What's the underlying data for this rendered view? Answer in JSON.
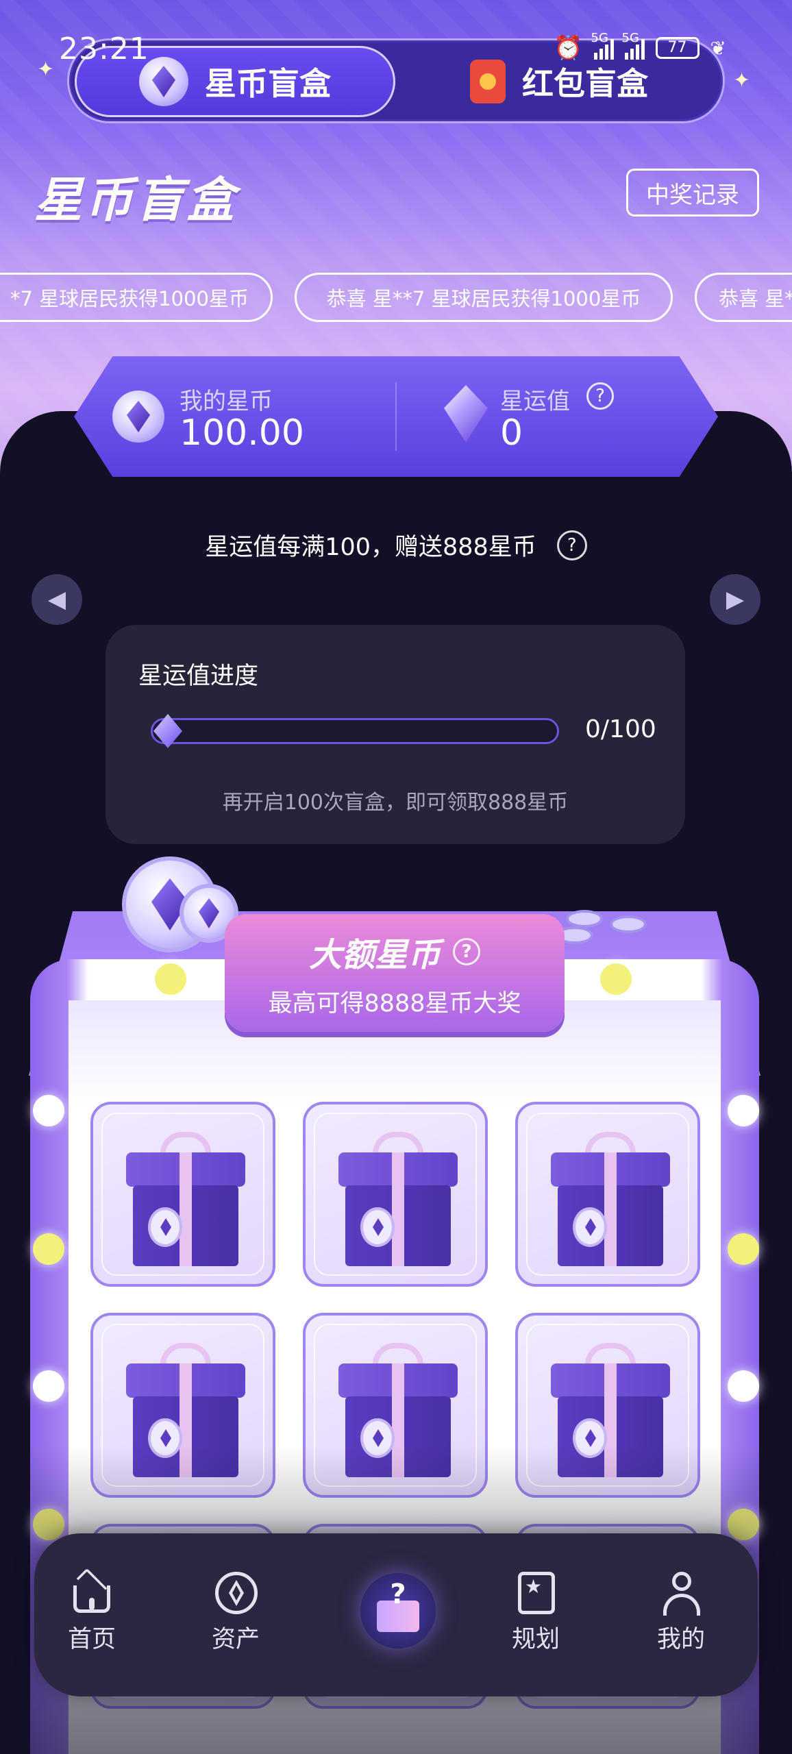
{
  "status_bar": {
    "time": "23:21",
    "network_1": "5G",
    "network_2": "5G",
    "battery": "77"
  },
  "top_tabs": [
    {
      "label": "星币盲盒",
      "active": true
    },
    {
      "label": "红包盲盒",
      "active": false
    }
  ],
  "header": {
    "title": "星币盲盒",
    "records_button": "中奖记录"
  },
  "ticker": [
    "*7 星球居民获得1000星币",
    "恭喜 星**7 星球居民获得1000星币",
    "恭喜 星*"
  ],
  "balance": {
    "coins_label": "我的星币",
    "coins_value": "100.00",
    "luck_label": "星运值",
    "luck_value": "0",
    "help_glyph": "?"
  },
  "star_info": {
    "text": "星运值每满100，赠送888星币",
    "help_glyph": "?"
  },
  "progress": {
    "title": "星运值进度",
    "count": "0/100",
    "fraction": 0,
    "hint": "再开启100次盲盒，即可领取888星币"
  },
  "prize_banner": {
    "title": "大额星币",
    "help_glyph": "?",
    "subtitle": "最高可得8888星币大奖"
  },
  "boxes": [
    {
      "icon": "gift-box-icon"
    },
    {
      "icon": "gift-box-icon"
    },
    {
      "icon": "gift-box-icon"
    },
    {
      "icon": "gift-box-icon"
    },
    {
      "icon": "gift-box-icon"
    },
    {
      "icon": "gift-box-icon"
    }
  ],
  "bottom_nav": [
    {
      "label": "首页",
      "icon": "home-icon"
    },
    {
      "label": "资产",
      "icon": "asset-icon"
    },
    {
      "label": "",
      "icon": "blind-box-icon"
    },
    {
      "label": "规划",
      "icon": "plan-icon"
    },
    {
      "label": "我的",
      "icon": "profile-icon"
    }
  ],
  "colors": {
    "accent": "#5a3fe0",
    "background": "#121026",
    "card": "#262439",
    "banner_pink": "#ec8ad8",
    "bulb_yellow": "#f2f27a"
  }
}
